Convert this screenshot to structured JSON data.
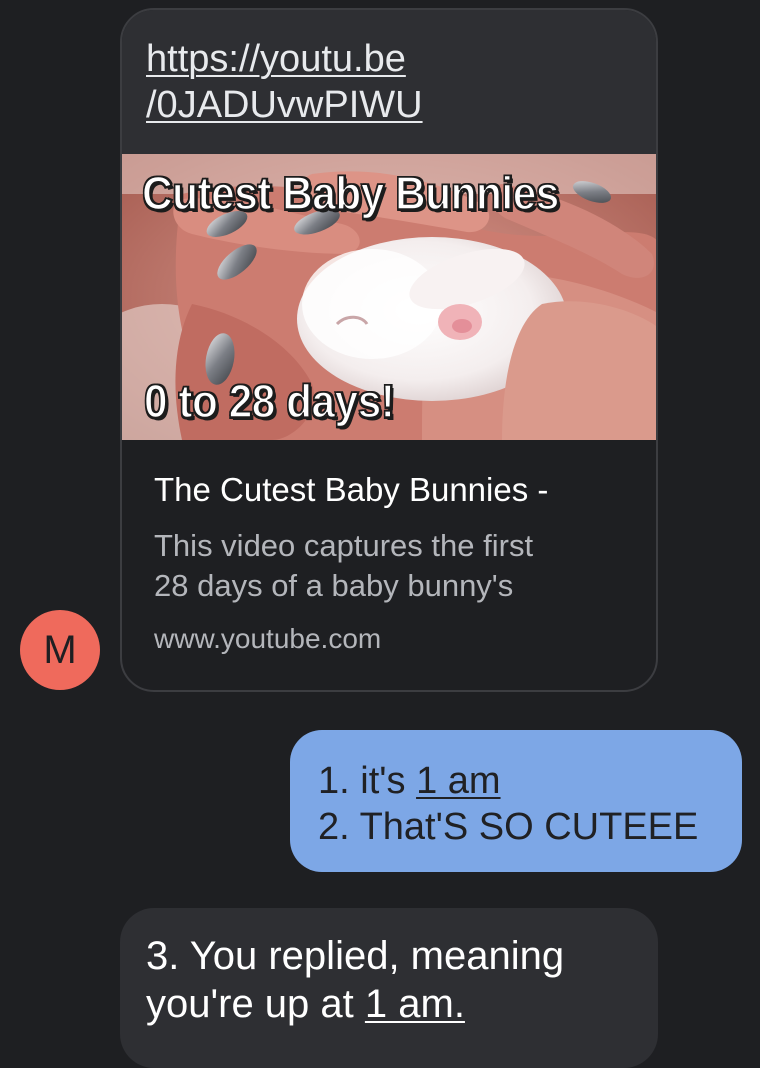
{
  "link_message": {
    "url_line1": "https://youtu.be",
    "url_line2": "/0JADUvwPIWU",
    "thumbnail": {
      "title_text": "Cutest Baby Bunnies",
      "subtitle_text": "0 to 28 days!"
    },
    "preview_title": "The Cutest Baby Bunnies -",
    "preview_desc_line1": "This video captures the first",
    "preview_desc_line2": "28 days of a baby bunny's",
    "preview_domain": "www.youtube.com"
  },
  "sender_avatar": {
    "initial": "M",
    "color": "#ef6a5c"
  },
  "outgoing_message": {
    "line1_prefix": "1. it's ",
    "line1_link": "1 am",
    "line2": "2. That'S SO CUTEEE",
    "bubble_color": "#7da7e6"
  },
  "incoming_message": {
    "line1": "3. You replied, meaning",
    "line2_prefix": "you're up at ",
    "line2_link": "1 am."
  },
  "colors": {
    "background": "#1e1f22",
    "incoming_bubble": "#2e2f33"
  }
}
